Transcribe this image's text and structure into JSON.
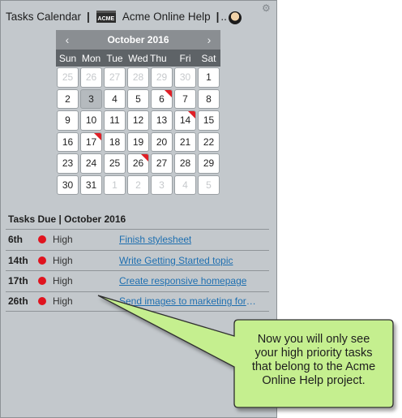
{
  "header": {
    "title": "Tasks Calendar",
    "separator": "|",
    "project_logo_text": "ACME",
    "project_name": "Acme Online Help",
    "separator2": "|",
    "ellipsis": ".."
  },
  "calendar": {
    "month_label": "October 2016",
    "prev": "‹",
    "next": "›",
    "weekdays": [
      "Sun",
      "Mon",
      "Tue",
      "Wed",
      "Thu",
      "Fri",
      "Sat"
    ],
    "days": [
      {
        "n": "25",
        "other": true
      },
      {
        "n": "26",
        "other": true
      },
      {
        "n": "27",
        "other": true
      },
      {
        "n": "28",
        "other": true
      },
      {
        "n": "29",
        "other": true
      },
      {
        "n": "30",
        "other": true
      },
      {
        "n": "1"
      },
      {
        "n": "2"
      },
      {
        "n": "3",
        "today": true
      },
      {
        "n": "4"
      },
      {
        "n": "5"
      },
      {
        "n": "6",
        "flag": true
      },
      {
        "n": "7"
      },
      {
        "n": "8"
      },
      {
        "n": "9"
      },
      {
        "n": "10"
      },
      {
        "n": "11"
      },
      {
        "n": "12"
      },
      {
        "n": "13"
      },
      {
        "n": "14",
        "flag": true
      },
      {
        "n": "15"
      },
      {
        "n": "16"
      },
      {
        "n": "17",
        "flag": true
      },
      {
        "n": "18"
      },
      {
        "n": "19"
      },
      {
        "n": "20"
      },
      {
        "n": "21"
      },
      {
        "n": "22"
      },
      {
        "n": "23"
      },
      {
        "n": "24"
      },
      {
        "n": "25"
      },
      {
        "n": "26",
        "flag": true
      },
      {
        "n": "27"
      },
      {
        "n": "28"
      },
      {
        "n": "29"
      },
      {
        "n": "30"
      },
      {
        "n": "31"
      },
      {
        "n": "1",
        "other": true
      },
      {
        "n": "2",
        "other": true
      },
      {
        "n": "3",
        "other": true
      },
      {
        "n": "4",
        "other": true
      },
      {
        "n": "5",
        "other": true
      }
    ]
  },
  "tasks": {
    "title": "Tasks Due  |  October 2016",
    "items": [
      {
        "day": "6th",
        "priority": "High",
        "name": "Finish stylesheet"
      },
      {
        "day": "14th",
        "priority": "High",
        "name": "Write Getting Started topic"
      },
      {
        "day": "17th",
        "priority": "High",
        "name": "Create responsive homepage"
      },
      {
        "day": "26th",
        "priority": "High",
        "name": "Send images to marketing for review"
      }
    ]
  },
  "callout": {
    "line1": "Now you will only see",
    "line2": "your high priority tasks",
    "line3": "that belong to the Acme",
    "line4": "Online Help project."
  },
  "colors": {
    "panel_bg": "#c3c8cc",
    "flag_red": "#e01f26",
    "link_blue": "#1e6fb0",
    "callout_green": "#c5ef8f"
  }
}
